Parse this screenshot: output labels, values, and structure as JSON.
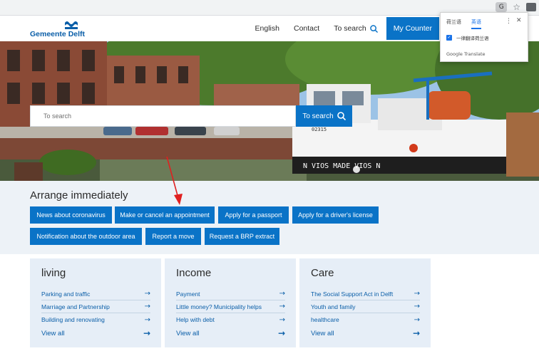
{
  "header": {
    "logo_text": "Gemeente Delft",
    "nav": {
      "english": "English",
      "contact": "Contact",
      "to_search": "To search",
      "my_counter": "My Counter"
    }
  },
  "hero": {
    "search_placeholder": "To search",
    "search_button": "To search",
    "boat_name": "N VIOS  MADE  VIOS N",
    "boat_number": "02315"
  },
  "translate_popup": {
    "tab_dutch": "荷兰语",
    "tab_chinese": "英语",
    "always_translate": "一律翻译荷兰语",
    "brand": "Google Translate"
  },
  "arrange": {
    "title": "Arrange immediately",
    "buttons": [
      "News about coronavirus",
      "Make or cancel an appointment",
      "Apply for a passport",
      "Apply for a driver's license",
      "Notification about the outdoor area",
      "Report a move",
      "Request a BRP extract"
    ]
  },
  "cards": [
    {
      "title": "living",
      "links": [
        "Parking and traffic",
        "Marriage and Partnership",
        "Building and renovating"
      ],
      "view_all": "View all"
    },
    {
      "title": "Income",
      "links": [
        "Payment",
        "Little money? Municipality helps",
        "Help with debt"
      ],
      "view_all": "View all"
    },
    {
      "title": "Care",
      "links": [
        "The Social Support Act in Delft",
        "Youth and family",
        "healthcare"
      ],
      "view_all": "View all"
    }
  ],
  "colors": {
    "brand_blue": "#0a73c7",
    "link_blue": "#0a5ea8",
    "band_bg": "#edf2f7",
    "card_bg": "#e6eef7",
    "arrow_red": "#e02020"
  },
  "icons": {
    "arrow": "→",
    "more": "⋮",
    "close": "✕"
  }
}
